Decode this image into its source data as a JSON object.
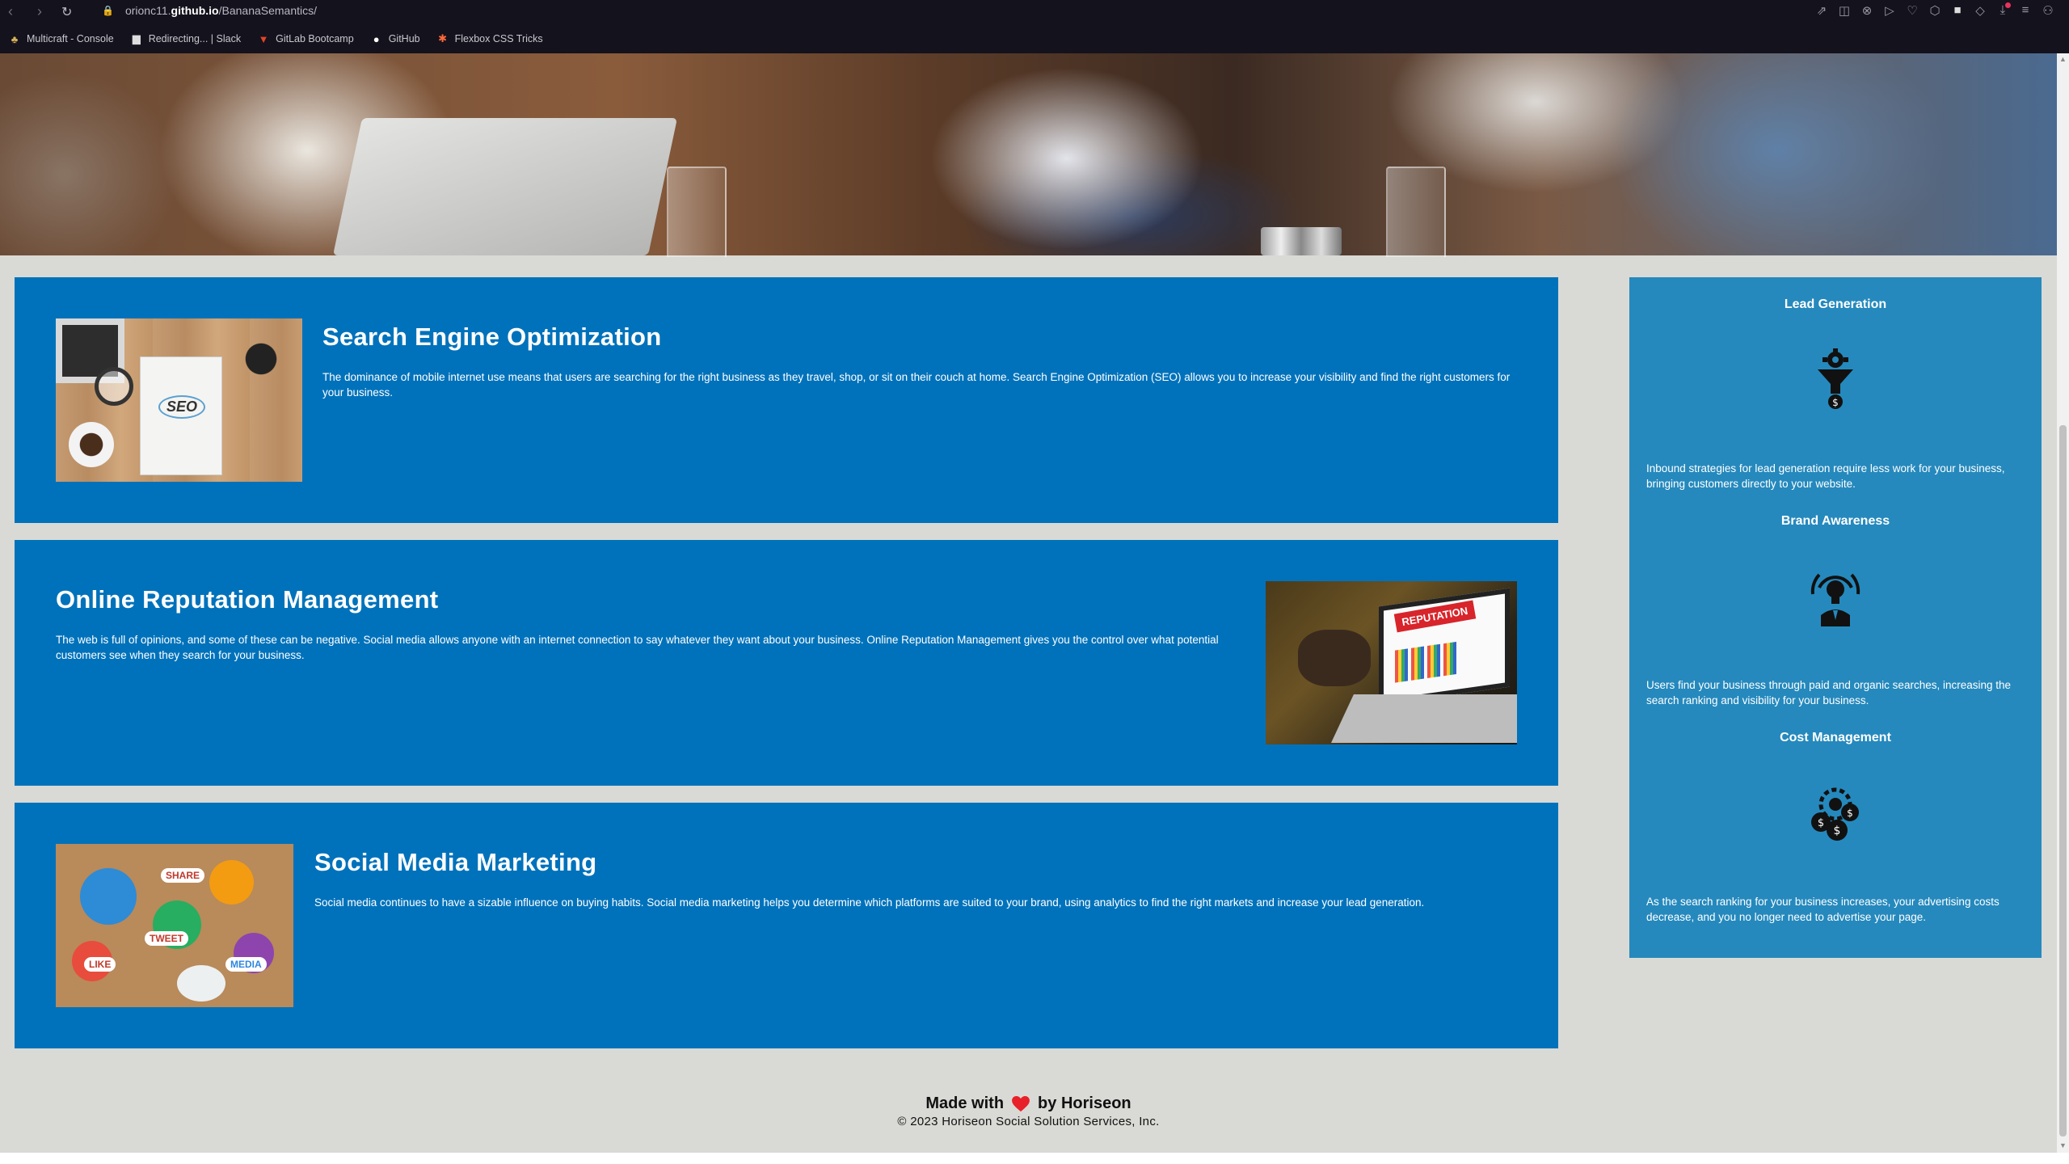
{
  "browser": {
    "url_prefix": "orionc11.",
    "url_domain": "github.io",
    "url_path": "/BananaSemantics/",
    "bookmarks": [
      {
        "label": "Multicraft - Console",
        "icon": "multicraft-icon"
      },
      {
        "label": "Redirecting... | Slack",
        "icon": "document-icon"
      },
      {
        "label": "GitLab Bootcamp",
        "icon": "gitlab-icon"
      },
      {
        "label": "GitHub",
        "icon": "github-icon"
      },
      {
        "label": "Flexbox CSS Tricks",
        "icon": "asterisk-icon"
      }
    ]
  },
  "content": {
    "seo": {
      "title": "Search Engine Optimization",
      "body": "The dominance of mobile internet use means that users are searching for the right business as they travel, shop, or sit on their couch at home. Search Engine Optimization (SEO) allows you to increase your visibility and find the right customers for your business.",
      "image_text": "SEO"
    },
    "reputation": {
      "title": "Online Reputation Management",
      "body": "The web is full of opinions, and some of these can be negative. Social media allows anyone with an internet connection to say whatever they want about your business. Online Reputation Management gives you the control over what potential customers see when they search for your business.",
      "image_text": "REPUTATION"
    },
    "social": {
      "title": "Social Media Marketing",
      "body": "Social media continues to have a sizable influence on buying habits. Social media marketing helps you determine which platforms are suited to your brand, using analytics to find the right markets and increase your lead generation.",
      "image_tags": [
        "SHARE",
        "TWEET",
        "LIKE",
        "MEDIA"
      ]
    }
  },
  "benefits": [
    {
      "title": "Lead Generation",
      "icon": "lead-generation-icon",
      "body": "Inbound strategies for lead generation require less work for your business, bringing customers directly to your website."
    },
    {
      "title": "Brand Awareness",
      "icon": "brand-awareness-icon",
      "body": "Users find your business through paid and organic searches, increasing the search ranking and visibility for your business."
    },
    {
      "title": "Cost Management",
      "icon": "cost-management-icon",
      "body": "As the search ranking for your business increases, your advertising costs decrease, and you no longer need to advertise your page."
    }
  ],
  "footer": {
    "made_with": "Made with",
    "by": "by Horiseon",
    "copyright": "© 2023 Horiseon Social Solution Services, Inc."
  },
  "colors": {
    "content_blue": "#0072bb",
    "aside_blue": "#2589bd",
    "page_bg": "#d9dad5",
    "heart": "#e8202a"
  }
}
